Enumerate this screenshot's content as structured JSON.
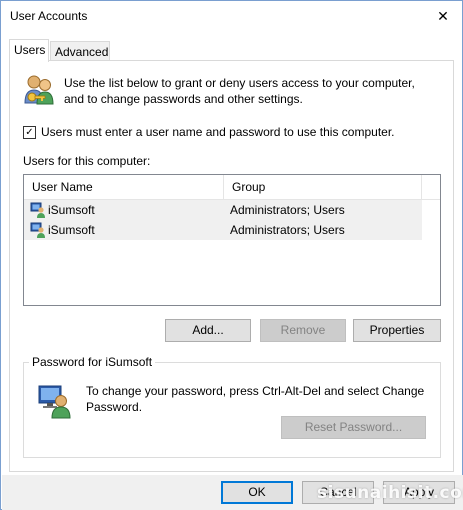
{
  "window": {
    "title": "User Accounts",
    "close_glyph": "✕"
  },
  "tabs": [
    {
      "label": "Users",
      "active": true
    },
    {
      "label": "Advanced",
      "active": false
    }
  ],
  "intro": {
    "icon": "users-keys-icon",
    "text": "Use the list below to grant or deny users access to your computer, and to change passwords and other settings."
  },
  "require_login": {
    "checked": true,
    "check_glyph": "✓",
    "label": "Users must enter a user name and password to use this computer."
  },
  "users_list": {
    "label": "Users for this computer:",
    "columns": [
      "User Name",
      "Group"
    ],
    "rows": [
      {
        "name": "iSumsoft",
        "group": "Administrators; Users"
      },
      {
        "name": "iSumsoft",
        "group": "Administrators; Users"
      }
    ]
  },
  "list_buttons": {
    "add": "Add...",
    "remove": "Remove",
    "properties": "Properties"
  },
  "password_group": {
    "legend": "Password for iSumsoft",
    "icon": "user-computer-icon",
    "text": "To change your password, press Ctrl-Alt-Del and select Change Password.",
    "reset_button": "Reset Password..."
  },
  "footer": {
    "ok": "OK",
    "cancel": "Cancel",
    "apply": "Apply"
  },
  "watermark": "sisunaihisit.com",
  "colors": {
    "accent": "#0078d7",
    "row_bg": "#f0f0f0",
    "disabled_text": "#838383"
  }
}
